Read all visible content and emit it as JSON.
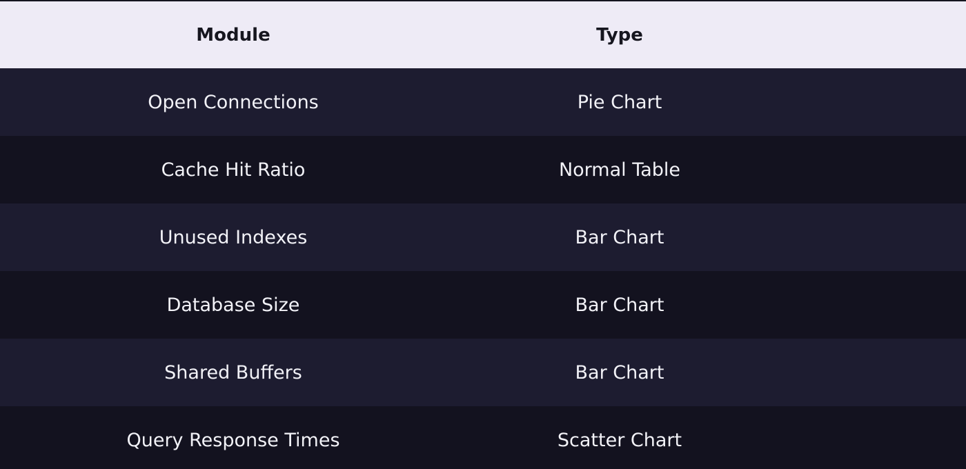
{
  "table": {
    "headers": [
      "Module",
      "Type"
    ],
    "rows": [
      [
        "Open Connections",
        "Pie Chart"
      ],
      [
        "Cache Hit Ratio",
        "Normal Table"
      ],
      [
        "Unused Indexes",
        "Bar Chart"
      ],
      [
        "Database Size",
        "Bar Chart"
      ],
      [
        "Shared Buffers",
        "Bar Chart"
      ],
      [
        "Query Response Times",
        "Scatter Chart"
      ]
    ]
  },
  "colors": {
    "header_bg": "#eeebf6",
    "header_text": "#16161f",
    "row_odd_bg": "#1d1c30",
    "row_even_bg": "#13121f",
    "cell_text": "#f2f2f7"
  }
}
